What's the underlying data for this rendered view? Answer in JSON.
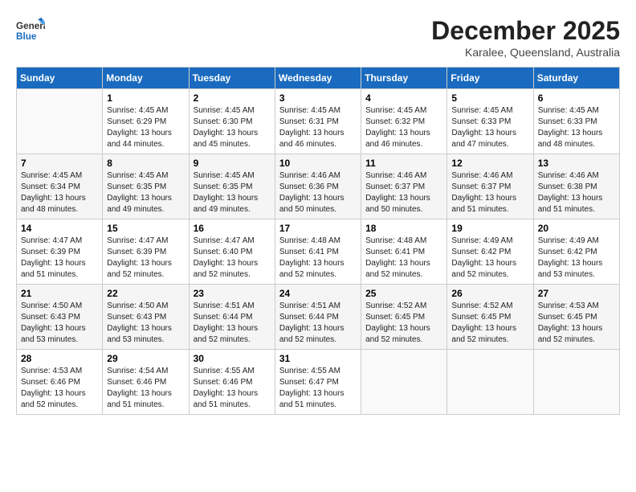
{
  "header": {
    "logo_general": "General",
    "logo_blue": "Blue",
    "month_year": "December 2025",
    "location": "Karalee, Queensland, Australia"
  },
  "weekdays": [
    "Sunday",
    "Monday",
    "Tuesday",
    "Wednesday",
    "Thursday",
    "Friday",
    "Saturday"
  ],
  "weeks": [
    [
      {
        "day": "",
        "sunrise": "",
        "sunset": "",
        "daylight": ""
      },
      {
        "day": "1",
        "sunrise": "Sunrise: 4:45 AM",
        "sunset": "Sunset: 6:29 PM",
        "daylight": "Daylight: 13 hours and 44 minutes."
      },
      {
        "day": "2",
        "sunrise": "Sunrise: 4:45 AM",
        "sunset": "Sunset: 6:30 PM",
        "daylight": "Daylight: 13 hours and 45 minutes."
      },
      {
        "day": "3",
        "sunrise": "Sunrise: 4:45 AM",
        "sunset": "Sunset: 6:31 PM",
        "daylight": "Daylight: 13 hours and 46 minutes."
      },
      {
        "day": "4",
        "sunrise": "Sunrise: 4:45 AM",
        "sunset": "Sunset: 6:32 PM",
        "daylight": "Daylight: 13 hours and 46 minutes."
      },
      {
        "day": "5",
        "sunrise": "Sunrise: 4:45 AM",
        "sunset": "Sunset: 6:33 PM",
        "daylight": "Daylight: 13 hours and 47 minutes."
      },
      {
        "day": "6",
        "sunrise": "Sunrise: 4:45 AM",
        "sunset": "Sunset: 6:33 PM",
        "daylight": "Daylight: 13 hours and 48 minutes."
      }
    ],
    [
      {
        "day": "7",
        "sunrise": "Sunrise: 4:45 AM",
        "sunset": "Sunset: 6:34 PM",
        "daylight": "Daylight: 13 hours and 48 minutes."
      },
      {
        "day": "8",
        "sunrise": "Sunrise: 4:45 AM",
        "sunset": "Sunset: 6:35 PM",
        "daylight": "Daylight: 13 hours and 49 minutes."
      },
      {
        "day": "9",
        "sunrise": "Sunrise: 4:45 AM",
        "sunset": "Sunset: 6:35 PM",
        "daylight": "Daylight: 13 hours and 49 minutes."
      },
      {
        "day": "10",
        "sunrise": "Sunrise: 4:46 AM",
        "sunset": "Sunset: 6:36 PM",
        "daylight": "Daylight: 13 hours and 50 minutes."
      },
      {
        "day": "11",
        "sunrise": "Sunrise: 4:46 AM",
        "sunset": "Sunset: 6:37 PM",
        "daylight": "Daylight: 13 hours and 50 minutes."
      },
      {
        "day": "12",
        "sunrise": "Sunrise: 4:46 AM",
        "sunset": "Sunset: 6:37 PM",
        "daylight": "Daylight: 13 hours and 51 minutes."
      },
      {
        "day": "13",
        "sunrise": "Sunrise: 4:46 AM",
        "sunset": "Sunset: 6:38 PM",
        "daylight": "Daylight: 13 hours and 51 minutes."
      }
    ],
    [
      {
        "day": "14",
        "sunrise": "Sunrise: 4:47 AM",
        "sunset": "Sunset: 6:39 PM",
        "daylight": "Daylight: 13 hours and 51 minutes."
      },
      {
        "day": "15",
        "sunrise": "Sunrise: 4:47 AM",
        "sunset": "Sunset: 6:39 PM",
        "daylight": "Daylight: 13 hours and 52 minutes."
      },
      {
        "day": "16",
        "sunrise": "Sunrise: 4:47 AM",
        "sunset": "Sunset: 6:40 PM",
        "daylight": "Daylight: 13 hours and 52 minutes."
      },
      {
        "day": "17",
        "sunrise": "Sunrise: 4:48 AM",
        "sunset": "Sunset: 6:41 PM",
        "daylight": "Daylight: 13 hours and 52 minutes."
      },
      {
        "day": "18",
        "sunrise": "Sunrise: 4:48 AM",
        "sunset": "Sunset: 6:41 PM",
        "daylight": "Daylight: 13 hours and 52 minutes."
      },
      {
        "day": "19",
        "sunrise": "Sunrise: 4:49 AM",
        "sunset": "Sunset: 6:42 PM",
        "daylight": "Daylight: 13 hours and 52 minutes."
      },
      {
        "day": "20",
        "sunrise": "Sunrise: 4:49 AM",
        "sunset": "Sunset: 6:42 PM",
        "daylight": "Daylight: 13 hours and 53 minutes."
      }
    ],
    [
      {
        "day": "21",
        "sunrise": "Sunrise: 4:50 AM",
        "sunset": "Sunset: 6:43 PM",
        "daylight": "Daylight: 13 hours and 53 minutes."
      },
      {
        "day": "22",
        "sunrise": "Sunrise: 4:50 AM",
        "sunset": "Sunset: 6:43 PM",
        "daylight": "Daylight: 13 hours and 53 minutes."
      },
      {
        "day": "23",
        "sunrise": "Sunrise: 4:51 AM",
        "sunset": "Sunset: 6:44 PM",
        "daylight": "Daylight: 13 hours and 52 minutes."
      },
      {
        "day": "24",
        "sunrise": "Sunrise: 4:51 AM",
        "sunset": "Sunset: 6:44 PM",
        "daylight": "Daylight: 13 hours and 52 minutes."
      },
      {
        "day": "25",
        "sunrise": "Sunrise: 4:52 AM",
        "sunset": "Sunset: 6:45 PM",
        "daylight": "Daylight: 13 hours and 52 minutes."
      },
      {
        "day": "26",
        "sunrise": "Sunrise: 4:52 AM",
        "sunset": "Sunset: 6:45 PM",
        "daylight": "Daylight: 13 hours and 52 minutes."
      },
      {
        "day": "27",
        "sunrise": "Sunrise: 4:53 AM",
        "sunset": "Sunset: 6:45 PM",
        "daylight": "Daylight: 13 hours and 52 minutes."
      }
    ],
    [
      {
        "day": "28",
        "sunrise": "Sunrise: 4:53 AM",
        "sunset": "Sunset: 6:46 PM",
        "daylight": "Daylight: 13 hours and 52 minutes."
      },
      {
        "day": "29",
        "sunrise": "Sunrise: 4:54 AM",
        "sunset": "Sunset: 6:46 PM",
        "daylight": "Daylight: 13 hours and 51 minutes."
      },
      {
        "day": "30",
        "sunrise": "Sunrise: 4:55 AM",
        "sunset": "Sunset: 6:46 PM",
        "daylight": "Daylight: 13 hours and 51 minutes."
      },
      {
        "day": "31",
        "sunrise": "Sunrise: 4:55 AM",
        "sunset": "Sunset: 6:47 PM",
        "daylight": "Daylight: 13 hours and 51 minutes."
      },
      {
        "day": "",
        "sunrise": "",
        "sunset": "",
        "daylight": ""
      },
      {
        "day": "",
        "sunrise": "",
        "sunset": "",
        "daylight": ""
      },
      {
        "day": "",
        "sunrise": "",
        "sunset": "",
        "daylight": ""
      }
    ]
  ]
}
